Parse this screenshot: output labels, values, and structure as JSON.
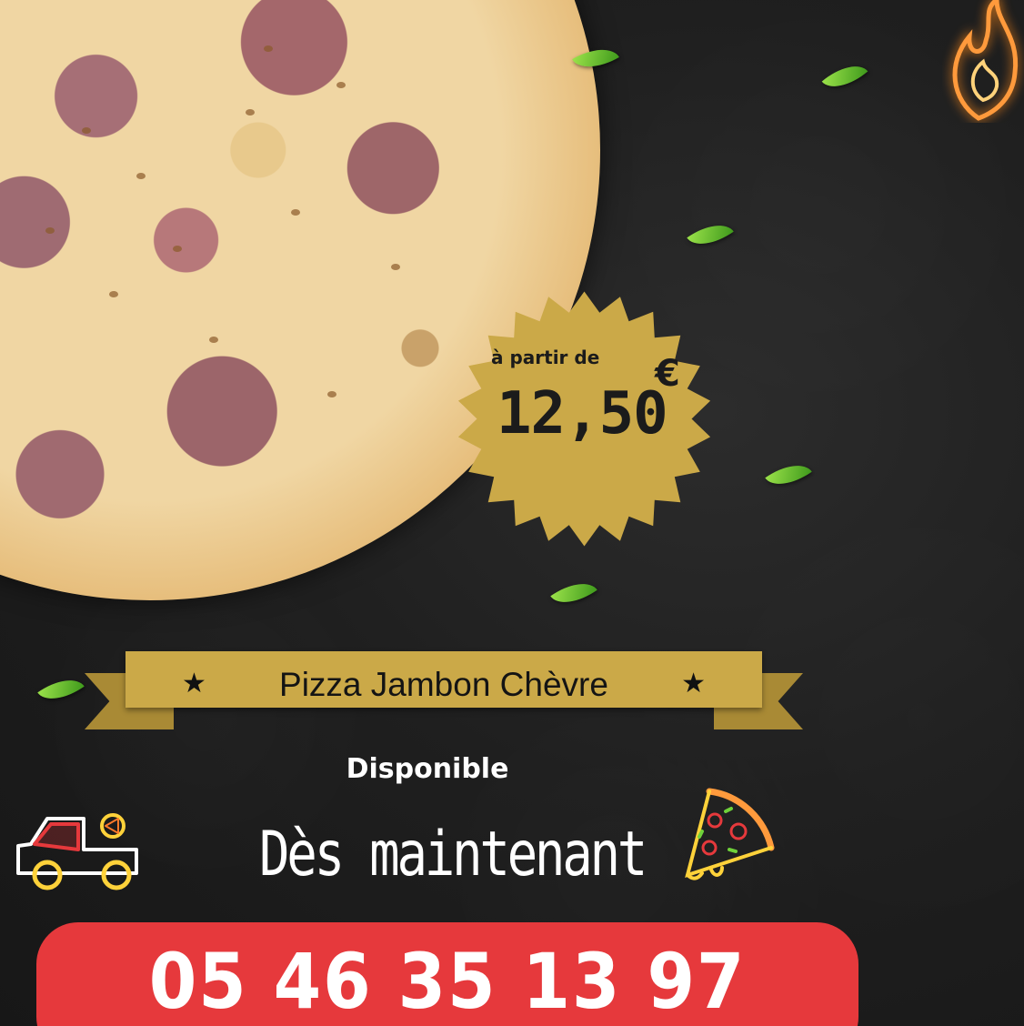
{
  "price": {
    "prefix": "à partir de",
    "value": "12,50",
    "currency": "€"
  },
  "ribbon": {
    "title": "Pizza Jambon Chèvre",
    "star_left": "★",
    "star_right": "★"
  },
  "availability": {
    "line1": "Disponible",
    "line2": "Dès maintenant"
  },
  "phone": "05 46 35 13 97",
  "colors": {
    "gold": "#cba948",
    "red": "#e6393c",
    "background": "#1e1e1e",
    "leaf": "#5bb52a"
  },
  "icons": [
    "delivery-truck-icon",
    "pizza-slice-icon",
    "flame-logo-icon",
    "basil-leaf-icon"
  ]
}
